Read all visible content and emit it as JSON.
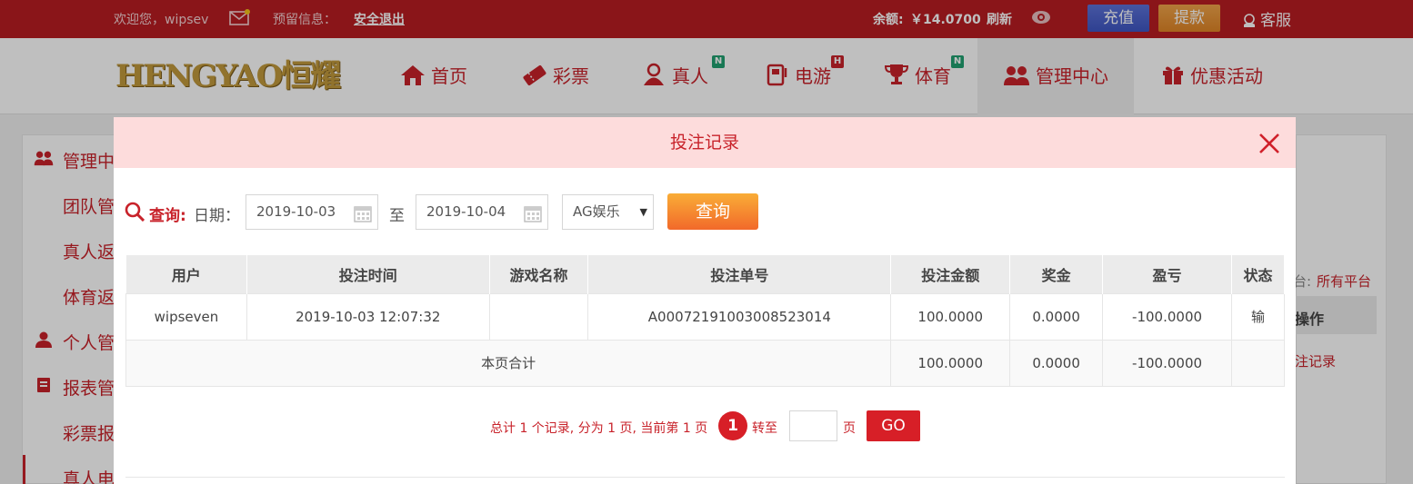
{
  "topbar": {
    "welcome": "欢迎您，wipsev",
    "reserved_label": "预留信息：",
    "logout": "安全退出",
    "balance_label": "余额:",
    "balance_value": "￥14.0700",
    "refresh": "刷新",
    "recharge": "充值",
    "withdraw": "提款",
    "service": "客服"
  },
  "nav": {
    "logo": "HENGYAO恒耀",
    "items": [
      {
        "label": "首页",
        "icon": "home-icon"
      },
      {
        "label": "彩票",
        "icon": "ticket-icon"
      },
      {
        "label": "真人",
        "icon": "person-icon",
        "badge": "N"
      },
      {
        "label": "电游",
        "icon": "arcade-icon",
        "badge": "H"
      },
      {
        "label": "体育",
        "icon": "trophy-icon",
        "badge": "N"
      },
      {
        "label": "管理中心",
        "icon": "users-icon"
      },
      {
        "label": "优惠活动",
        "icon": "gift-icon"
      }
    ]
  },
  "sidebar": {
    "items": [
      "管理中",
      "团队管",
      "真人返",
      "体育返",
      "个人管",
      "报表管",
      "彩票报",
      "真人电"
    ]
  },
  "right_panel": {
    "platform_label": "台:",
    "platform_value": "所有平台",
    "col_header": "操作",
    "link": "注记录"
  },
  "modal": {
    "title": "投注记录",
    "filter": {
      "query_label": "查询:",
      "date_label": "日期：",
      "start_date": "2019-10-03",
      "to_label": "至",
      "end_date": "2019-10-04",
      "platform": "AG娱乐",
      "query_button": "查询"
    },
    "table": {
      "headers": [
        "用户",
        "投注时间",
        "游戏名称",
        "投注单号",
        "投注金额",
        "奖金",
        "盈亏",
        "状态"
      ],
      "rows": [
        {
          "user": "wipseven",
          "time": "2019-10-03 12:07:32",
          "game": "",
          "order": "A00072191003008523014",
          "amount": "100.0000",
          "bonus": "0.0000",
          "profit": "-100.0000",
          "status": "输"
        }
      ],
      "summary": {
        "label": "本页合计",
        "amount": "100.0000",
        "bonus": "0.0000",
        "profit": "-100.0000"
      }
    },
    "pager": {
      "info": "总计 1 个记录, 分为 1 页, 当前第 1 页",
      "current": "1",
      "goto_label": "转至",
      "page_unit": "页",
      "go_button": "GO"
    }
  },
  "colors": {
    "brand_red": "#b81c22",
    "accent_red": "#c8222a",
    "query_orange": "#f2692a"
  }
}
